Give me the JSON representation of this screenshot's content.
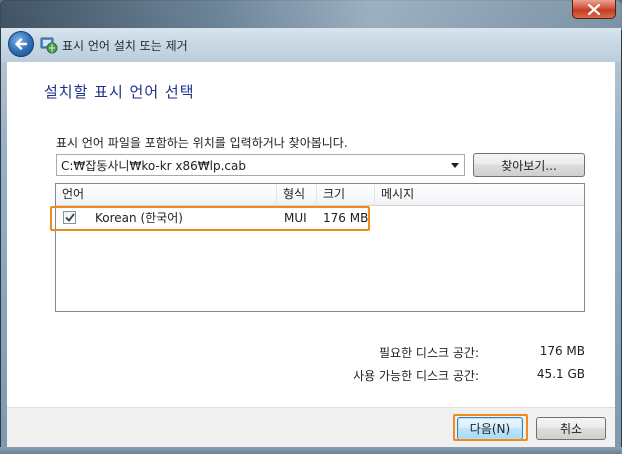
{
  "window": {
    "nav_title": "표시 언어 설치 또는 제거",
    "icons": {
      "back": "back-arrow-icon",
      "app": "language-globe-icon",
      "close": "close-icon"
    }
  },
  "page": {
    "heading": "설치할 표시 언어 선택",
    "instruction": "표시 언어 파일을 포함하는 위치를 입력하거나 찾아봅니다.",
    "path_value": "C:₩잡동사니₩ko-kr x86₩lp.cab",
    "browse_label": "찾아보기..."
  },
  "list": {
    "columns": [
      "언어",
      "형식",
      "크기",
      "메시지"
    ],
    "rows": [
      {
        "checked": true,
        "language": "Korean (한국어)",
        "type": "MUI",
        "size": "176 MB",
        "message": ""
      }
    ]
  },
  "disk": {
    "required_label": "필요한 디스크 공간:",
    "required_value": "176 MB",
    "available_label": "사용 가능한 디스크 공간:",
    "available_value": "45.1 GB"
  },
  "footer": {
    "next_label": "다음(N)",
    "cancel_label": "취소"
  },
  "colors": {
    "heading": "#1e3287",
    "highlight": "#f08a1c"
  }
}
